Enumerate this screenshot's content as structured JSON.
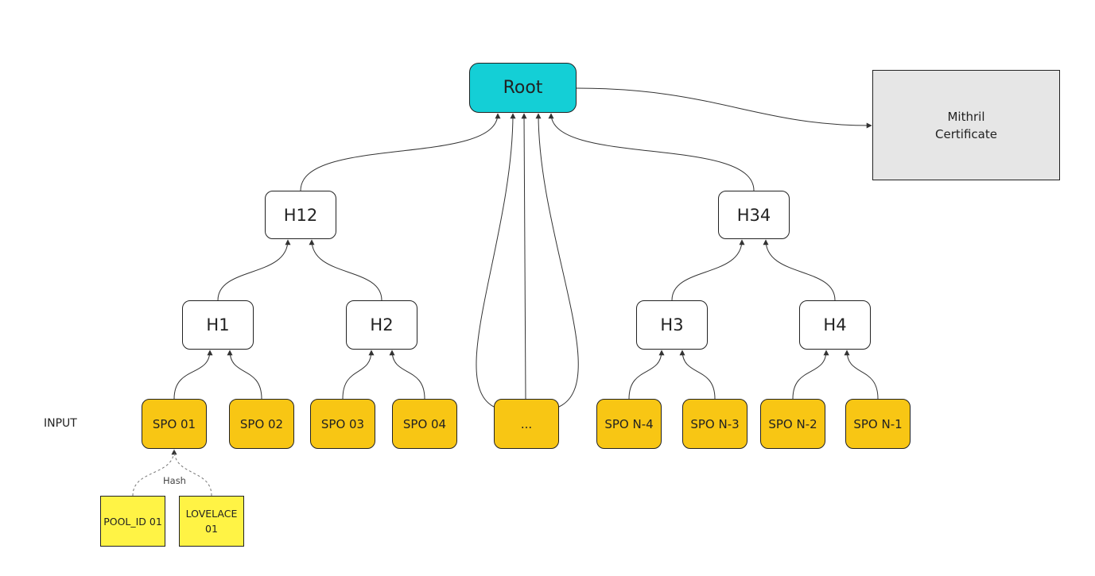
{
  "colors": {
    "root": "#14cfd6",
    "spo": "#f8c614",
    "leaf": "#fff345",
    "certificate": "#e6e6e6",
    "edge": "#333333"
  },
  "root": {
    "label": "Root"
  },
  "certificate": {
    "label_line1": "Mithril",
    "label_line2": "Certificate"
  },
  "level2": [
    {
      "label": "H12"
    },
    {
      "label": "H34"
    }
  ],
  "level1": [
    {
      "label": "H1"
    },
    {
      "label": "H2"
    },
    {
      "label": "H3"
    },
    {
      "label": "H4"
    }
  ],
  "input_label": "INPUT",
  "inputs": [
    {
      "label": "SPO 01"
    },
    {
      "label": "SPO 02"
    },
    {
      "label": "SPO 03"
    },
    {
      "label": "SPO 04"
    },
    {
      "label": "..."
    },
    {
      "label": "SPO N-4"
    },
    {
      "label": "SPO N-3"
    },
    {
      "label": "SPO N-2"
    },
    {
      "label": "SPO N-1"
    }
  ],
  "hash_label": "Hash",
  "leaves": [
    {
      "label": "POOL_ID 01"
    },
    {
      "label_line1": "LOVELACE",
      "label_line2": "01"
    }
  ]
}
